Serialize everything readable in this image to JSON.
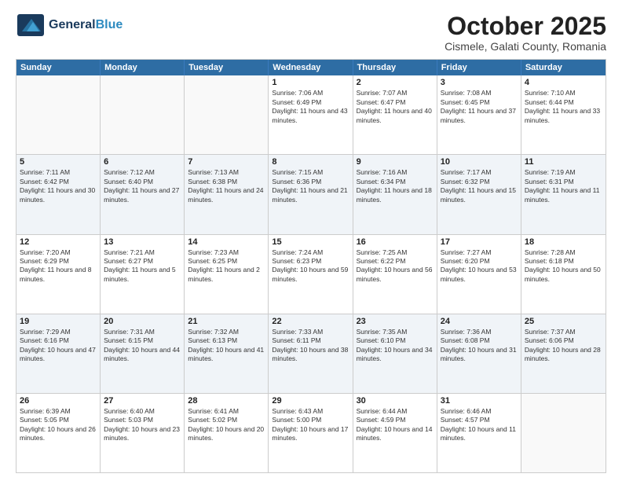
{
  "header": {
    "logo_general": "General",
    "logo_blue": "Blue",
    "month_title": "October 2025",
    "location": "Cismele, Galati County, Romania"
  },
  "days_of_week": [
    "Sunday",
    "Monday",
    "Tuesday",
    "Wednesday",
    "Thursday",
    "Friday",
    "Saturday"
  ],
  "weeks": [
    [
      {
        "day": "",
        "info": ""
      },
      {
        "day": "",
        "info": ""
      },
      {
        "day": "",
        "info": ""
      },
      {
        "day": "1",
        "info": "Sunrise: 7:06 AM\nSunset: 6:49 PM\nDaylight: 11 hours and 43 minutes."
      },
      {
        "day": "2",
        "info": "Sunrise: 7:07 AM\nSunset: 6:47 PM\nDaylight: 11 hours and 40 minutes."
      },
      {
        "day": "3",
        "info": "Sunrise: 7:08 AM\nSunset: 6:45 PM\nDaylight: 11 hours and 37 minutes."
      },
      {
        "day": "4",
        "info": "Sunrise: 7:10 AM\nSunset: 6:44 PM\nDaylight: 11 hours and 33 minutes."
      }
    ],
    [
      {
        "day": "5",
        "info": "Sunrise: 7:11 AM\nSunset: 6:42 PM\nDaylight: 11 hours and 30 minutes."
      },
      {
        "day": "6",
        "info": "Sunrise: 7:12 AM\nSunset: 6:40 PM\nDaylight: 11 hours and 27 minutes."
      },
      {
        "day": "7",
        "info": "Sunrise: 7:13 AM\nSunset: 6:38 PM\nDaylight: 11 hours and 24 minutes."
      },
      {
        "day": "8",
        "info": "Sunrise: 7:15 AM\nSunset: 6:36 PM\nDaylight: 11 hours and 21 minutes."
      },
      {
        "day": "9",
        "info": "Sunrise: 7:16 AM\nSunset: 6:34 PM\nDaylight: 11 hours and 18 minutes."
      },
      {
        "day": "10",
        "info": "Sunrise: 7:17 AM\nSunset: 6:32 PM\nDaylight: 11 hours and 15 minutes."
      },
      {
        "day": "11",
        "info": "Sunrise: 7:19 AM\nSunset: 6:31 PM\nDaylight: 11 hours and 11 minutes."
      }
    ],
    [
      {
        "day": "12",
        "info": "Sunrise: 7:20 AM\nSunset: 6:29 PM\nDaylight: 11 hours and 8 minutes."
      },
      {
        "day": "13",
        "info": "Sunrise: 7:21 AM\nSunset: 6:27 PM\nDaylight: 11 hours and 5 minutes."
      },
      {
        "day": "14",
        "info": "Sunrise: 7:23 AM\nSunset: 6:25 PM\nDaylight: 11 hours and 2 minutes."
      },
      {
        "day": "15",
        "info": "Sunrise: 7:24 AM\nSunset: 6:23 PM\nDaylight: 10 hours and 59 minutes."
      },
      {
        "day": "16",
        "info": "Sunrise: 7:25 AM\nSunset: 6:22 PM\nDaylight: 10 hours and 56 minutes."
      },
      {
        "day": "17",
        "info": "Sunrise: 7:27 AM\nSunset: 6:20 PM\nDaylight: 10 hours and 53 minutes."
      },
      {
        "day": "18",
        "info": "Sunrise: 7:28 AM\nSunset: 6:18 PM\nDaylight: 10 hours and 50 minutes."
      }
    ],
    [
      {
        "day": "19",
        "info": "Sunrise: 7:29 AM\nSunset: 6:16 PM\nDaylight: 10 hours and 47 minutes."
      },
      {
        "day": "20",
        "info": "Sunrise: 7:31 AM\nSunset: 6:15 PM\nDaylight: 10 hours and 44 minutes."
      },
      {
        "day": "21",
        "info": "Sunrise: 7:32 AM\nSunset: 6:13 PM\nDaylight: 10 hours and 41 minutes."
      },
      {
        "day": "22",
        "info": "Sunrise: 7:33 AM\nSunset: 6:11 PM\nDaylight: 10 hours and 38 minutes."
      },
      {
        "day": "23",
        "info": "Sunrise: 7:35 AM\nSunset: 6:10 PM\nDaylight: 10 hours and 34 minutes."
      },
      {
        "day": "24",
        "info": "Sunrise: 7:36 AM\nSunset: 6:08 PM\nDaylight: 10 hours and 31 minutes."
      },
      {
        "day": "25",
        "info": "Sunrise: 7:37 AM\nSunset: 6:06 PM\nDaylight: 10 hours and 28 minutes."
      }
    ],
    [
      {
        "day": "26",
        "info": "Sunrise: 6:39 AM\nSunset: 5:05 PM\nDaylight: 10 hours and 26 minutes."
      },
      {
        "day": "27",
        "info": "Sunrise: 6:40 AM\nSunset: 5:03 PM\nDaylight: 10 hours and 23 minutes."
      },
      {
        "day": "28",
        "info": "Sunrise: 6:41 AM\nSunset: 5:02 PM\nDaylight: 10 hours and 20 minutes."
      },
      {
        "day": "29",
        "info": "Sunrise: 6:43 AM\nSunset: 5:00 PM\nDaylight: 10 hours and 17 minutes."
      },
      {
        "day": "30",
        "info": "Sunrise: 6:44 AM\nSunset: 4:59 PM\nDaylight: 10 hours and 14 minutes."
      },
      {
        "day": "31",
        "info": "Sunrise: 6:46 AM\nSunset: 4:57 PM\nDaylight: 10 hours and 11 minutes."
      },
      {
        "day": "",
        "info": ""
      }
    ]
  ]
}
